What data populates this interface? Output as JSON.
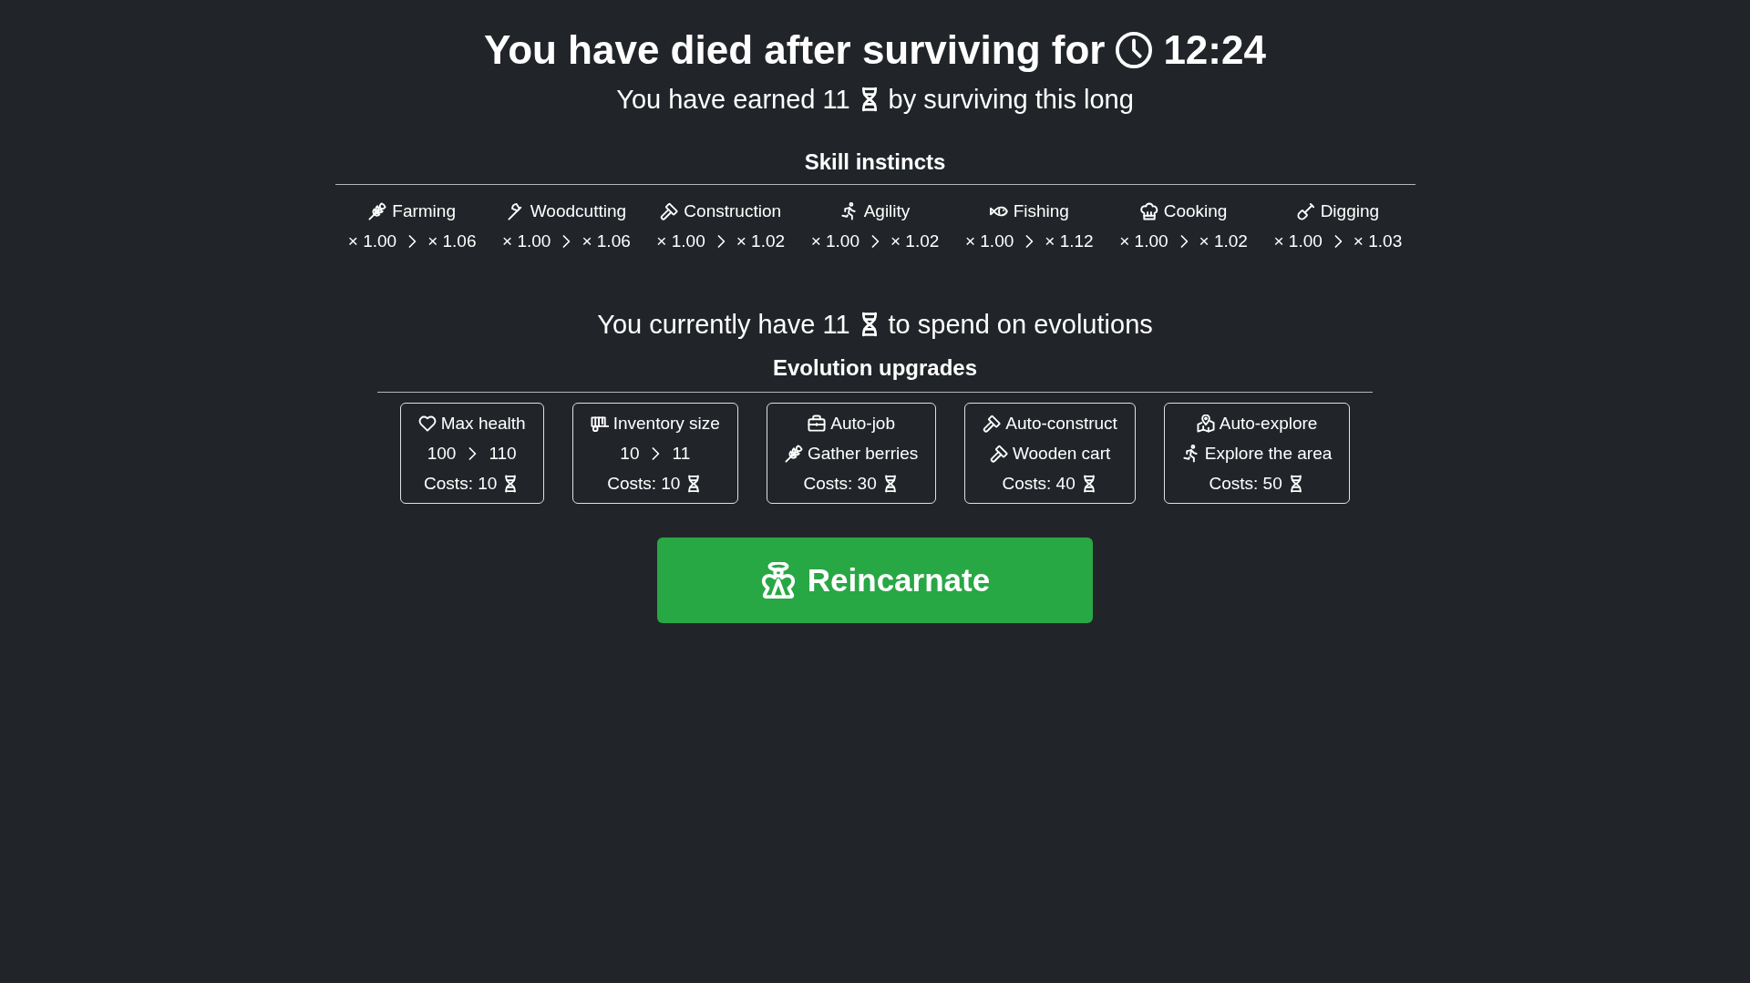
{
  "title": {
    "text": "You have died after surviving for",
    "time": "12:24"
  },
  "earned": {
    "before": "You have earned 11",
    "after": "by surviving this long"
  },
  "skill_instincts": {
    "heading": "Skill instincts",
    "skills": [
      {
        "kind": "farming",
        "name": "Farming",
        "from": "× 1.00",
        "to": "× 1.06"
      },
      {
        "kind": "woodcutting",
        "name": "Woodcutting",
        "from": "× 1.00",
        "to": "× 1.06"
      },
      {
        "kind": "construction",
        "name": "Construction",
        "from": "× 1.00",
        "to": "× 1.02"
      },
      {
        "kind": "agility",
        "name": "Agility",
        "from": "× 1.00",
        "to": "× 1.02"
      },
      {
        "kind": "fishing",
        "name": "Fishing",
        "from": "× 1.00",
        "to": "× 1.12"
      },
      {
        "kind": "cooking",
        "name": "Cooking",
        "from": "× 1.00",
        "to": "× 1.02"
      },
      {
        "kind": "digging",
        "name": "Digging",
        "from": "× 1.00",
        "to": "× 1.03"
      }
    ]
  },
  "balance": {
    "before": "You currently have 11",
    "after": "to spend on evolutions"
  },
  "evolution_upgrades": {
    "heading": "Evolution upgrades",
    "upgrades": [
      {
        "kind": "health",
        "name": "Max health",
        "detail": {
          "kind": "range",
          "from": "100",
          "to": "110"
        },
        "cost": "Costs: 10"
      },
      {
        "kind": "inventory",
        "name": "Inventory size",
        "detail": {
          "kind": "range",
          "from": "10",
          "to": "11"
        },
        "cost": "Costs: 10"
      },
      {
        "kind": "job",
        "name": "Auto-job",
        "detail": {
          "kind": "farming",
          "label": "Gather berries"
        },
        "cost": "Costs: 30"
      },
      {
        "kind": "construct",
        "name": "Auto-construct",
        "detail": {
          "kind": "construction",
          "label": "Wooden cart"
        },
        "cost": "Costs: 40"
      },
      {
        "kind": "explore",
        "name": "Auto-explore",
        "detail": {
          "kind": "agility",
          "label": "Explore the area"
        },
        "cost": "Costs: 50"
      }
    ]
  },
  "reincarnate_button": {
    "label": "Reincarnate"
  }
}
